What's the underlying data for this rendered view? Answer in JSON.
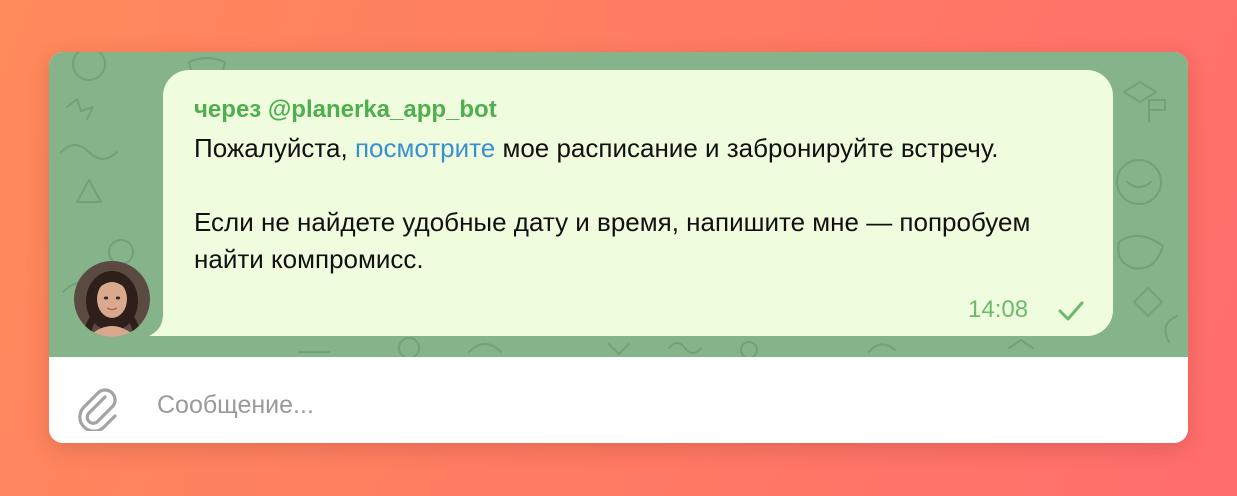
{
  "message": {
    "via": "через @planerka_app_bot",
    "line1_before": "Пожалуйста, ",
    "line1_link": "посмотрите",
    "line1_after": " мое расписание и забронируйте встречу.",
    "paragraph2": "Если не найдете удобные дату и время, напишите мне — попробуем найти компромисс.",
    "time": "14:08",
    "status_icon": "check-icon"
  },
  "composer": {
    "placeholder": "Сообщение...",
    "attach_icon": "paperclip-icon"
  },
  "colors": {
    "background_gradient_start": "#ff8a5c",
    "background_gradient_end": "#ff6d6d",
    "chat_background": "#86b48a",
    "bubble": "#effdde",
    "via_text": "#4fae4e",
    "link": "#3a8fd0",
    "time": "#6dbb6a"
  }
}
